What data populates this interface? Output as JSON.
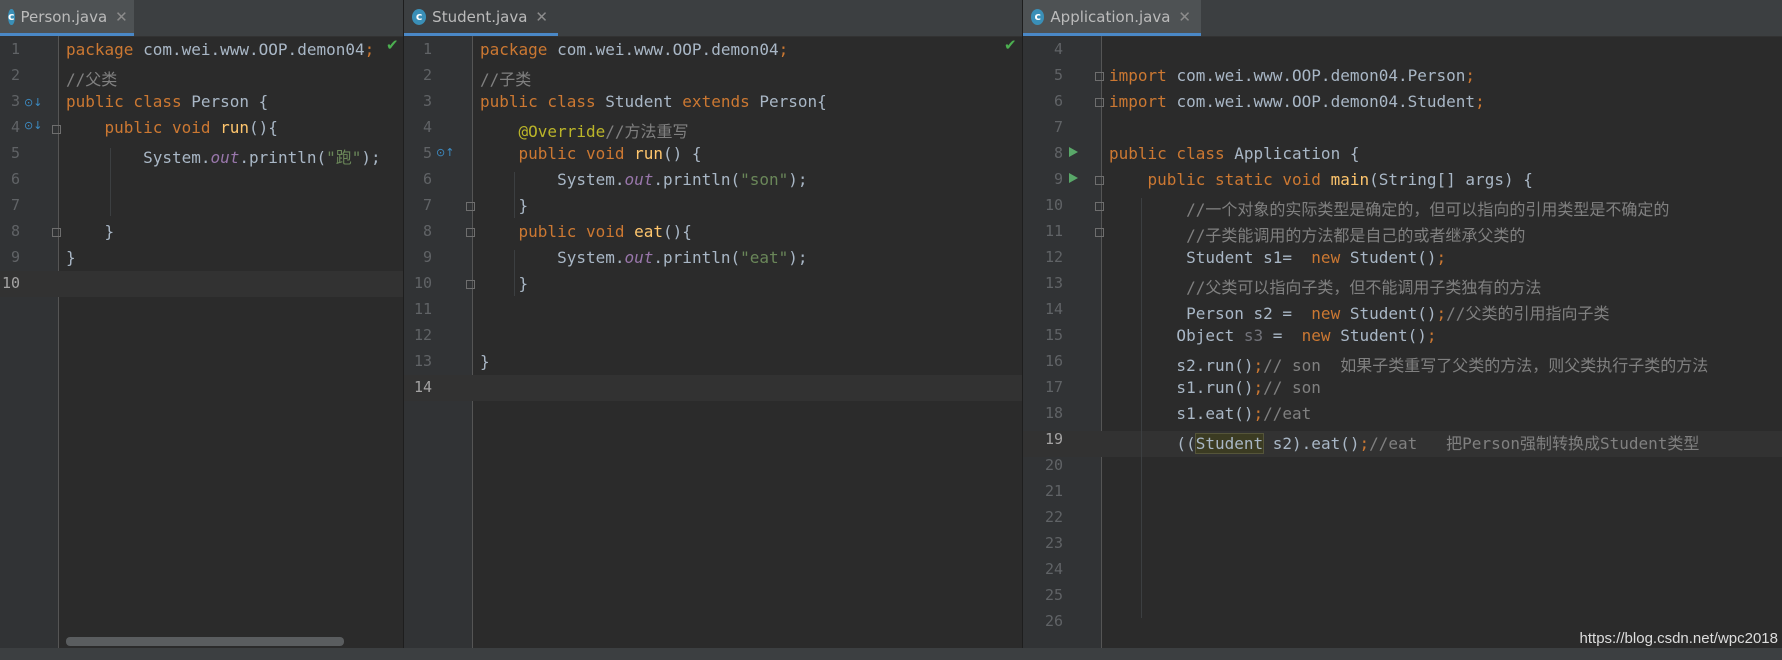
{
  "panes": [
    {
      "tab": {
        "label": "Person.java",
        "icon": "class-icon",
        "icon_glyph": "c",
        "close": "✕"
      },
      "line_numbers": [
        "1",
        "2",
        "3",
        "4",
        "5",
        "6",
        "7",
        "8",
        "9",
        "10"
      ],
      "current_line": "10",
      "lines": [
        [
          [
            "kw",
            "package "
          ],
          [
            "",
            "com.wei.www.OOP.demon04"
          ],
          [
            "kw",
            ";"
          ]
        ],
        [
          [
            "cm",
            "//父类"
          ]
        ],
        [
          [
            "kw",
            "public class "
          ],
          [
            "",
            "Person {"
          ]
        ],
        [
          [
            "",
            "    "
          ],
          [
            "kw",
            "public void "
          ],
          [
            "fn",
            "run"
          ],
          [
            "",
            "(){"
          ]
        ],
        [
          [
            "",
            "        System."
          ],
          [
            "fld",
            "out"
          ],
          [
            "",
            ".println("
          ],
          [
            "str",
            "\"跑\""
          ],
          [
            "",
            ");"
          ]
        ],
        [],
        [],
        [
          [
            "",
            "    }"
          ]
        ],
        [
          [
            "",
            "}"
          ]
        ],
        []
      ]
    },
    {
      "tab": {
        "label": "Student.java",
        "icon": "class-icon",
        "icon_glyph": "c",
        "close": "✕"
      },
      "line_numbers": [
        "1",
        "2",
        "3",
        "4",
        "5",
        "6",
        "7",
        "8",
        "9",
        "10",
        "11",
        "12",
        "13",
        "14"
      ],
      "current_line": "14",
      "lines": [
        [
          [
            "kw",
            "package "
          ],
          [
            "",
            "com.wei.www.OOP.demon04"
          ],
          [
            "kw",
            ";"
          ]
        ],
        [
          [
            "cm",
            "//子类"
          ]
        ],
        [
          [
            "kw",
            "public class "
          ],
          [
            "",
            "Student "
          ],
          [
            "kw",
            "extends "
          ],
          [
            "",
            "Person{"
          ]
        ],
        [
          [
            "",
            "    "
          ],
          [
            "ann",
            "@Override"
          ],
          [
            "cm",
            "//方法重写"
          ]
        ],
        [
          [
            "",
            "    "
          ],
          [
            "kw",
            "public void "
          ],
          [
            "fn",
            "run"
          ],
          [
            "",
            "() {"
          ]
        ],
        [
          [
            "",
            "        System."
          ],
          [
            "fld",
            "out"
          ],
          [
            "",
            ".println("
          ],
          [
            "str",
            "\"son\""
          ],
          [
            "",
            ");"
          ]
        ],
        [
          [
            "",
            "    }"
          ]
        ],
        [
          [
            "",
            "    "
          ],
          [
            "kw",
            "public void "
          ],
          [
            "fn",
            "eat"
          ],
          [
            "",
            "(){"
          ]
        ],
        [
          [
            "",
            "        System."
          ],
          [
            "fld",
            "out"
          ],
          [
            "",
            ".println("
          ],
          [
            "str",
            "\"eat\""
          ],
          [
            "",
            ");"
          ]
        ],
        [
          [
            "",
            "    }"
          ]
        ],
        [],
        [],
        [
          [
            "",
            "}"
          ]
        ],
        []
      ]
    },
    {
      "tab": {
        "label": "Application.java",
        "icon": "class-run-icon",
        "icon_glyph": "c",
        "close": "✕"
      },
      "line_numbers": [
        "4",
        "5",
        "6",
        "7",
        "8",
        "9",
        "10",
        "11",
        "12",
        "13",
        "14",
        "15",
        "16",
        "17",
        "18",
        "19",
        "20",
        "21",
        "22",
        "23",
        "24",
        "25",
        "26"
      ],
      "current_line": "19",
      "lines": [
        [],
        [
          [
            "kw",
            "import "
          ],
          [
            "",
            "com.wei.www.OOP.demon04.Person"
          ],
          [
            "kw",
            ";"
          ]
        ],
        [
          [
            "kw",
            "import "
          ],
          [
            "",
            "com.wei.www.OOP.demon04.Student"
          ],
          [
            "kw",
            ";"
          ]
        ],
        [],
        [
          [
            "kw",
            "public class "
          ],
          [
            "",
            "Application {"
          ]
        ],
        [
          [
            "",
            "    "
          ],
          [
            "kw",
            "public static void "
          ],
          [
            "fn",
            "main"
          ],
          [
            "",
            "(String[] args) {"
          ]
        ],
        [
          [
            "",
            "        "
          ],
          [
            "cm",
            "//一个对象的实际类型是确定的，但可以指向的引用类型是不确定的"
          ]
        ],
        [
          [
            "",
            "        "
          ],
          [
            "cm",
            "//子类能调用的方法都是自己的或者继承父类的"
          ]
        ],
        [
          [
            "",
            "        Student s1=  "
          ],
          [
            "kw",
            "new "
          ],
          [
            "",
            "Student()"
          ],
          [
            "kw",
            ";"
          ]
        ],
        [
          [
            "",
            "        "
          ],
          [
            "cm",
            "//父类可以指向子类，但不能调用子类独有的方法"
          ]
        ],
        [
          [
            "",
            "        Person s2 =  "
          ],
          [
            "kw",
            "new "
          ],
          [
            "",
            "Student()"
          ],
          [
            "kw",
            ";"
          ],
          [
            "cm",
            "//父类的引用指向子类"
          ]
        ],
        [
          [
            "",
            "       Object "
          ],
          [
            "unused",
            "s3"
          ],
          [
            "",
            " =  "
          ],
          [
            "kw",
            "new "
          ],
          [
            "",
            "Student()"
          ],
          [
            "kw",
            ";"
          ]
        ],
        [
          [
            "",
            "       s2.run()"
          ],
          [
            "kw",
            ";"
          ],
          [
            "cm",
            "// son  如果子类重写了父类的方法，则父类执行子类的方法"
          ]
        ],
        [
          [
            "",
            "       s1.run()"
          ],
          [
            "kw",
            ";"
          ],
          [
            "cm",
            "// son"
          ]
        ],
        [
          [
            "",
            "       s1.eat()"
          ],
          [
            "kw",
            ";"
          ],
          [
            "cm",
            "//eat"
          ]
        ],
        [
          [
            "",
            "       (("
          ],
          [
            "hl",
            "Student"
          ],
          [
            "",
            " s2).eat()"
          ],
          [
            "kw",
            ";"
          ],
          [
            "cm",
            "//eat   把Person强制转换成Student类型"
          ]
        ],
        [],
        [],
        [],
        [],
        [],
        [],
        []
      ]
    }
  ],
  "watermark": "https://blog.csdn.net/wpc2018"
}
